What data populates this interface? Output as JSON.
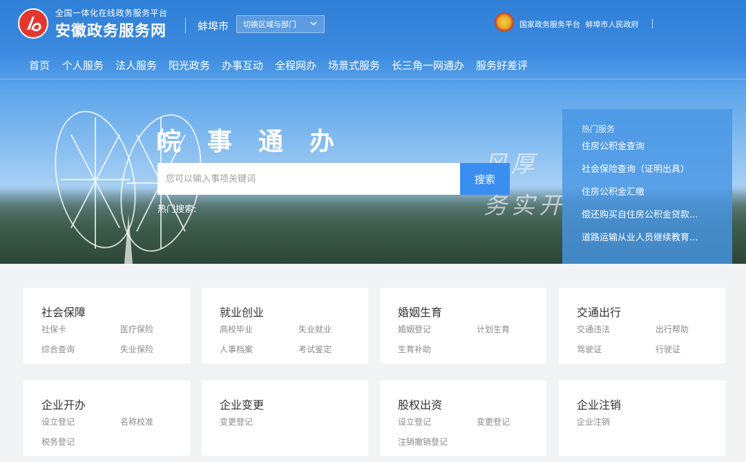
{
  "site": {
    "subtitle": "全国一体化在线政务服务平台",
    "title": "安徽政务服务网",
    "city": "蚌埠市",
    "switch_label": "切换区域与部门",
    "gov_links": [
      "国家政务服务平台",
      "蚌埠市人民政府"
    ]
  },
  "nav": [
    "首页",
    "个人服务",
    "法人服务",
    "阳光政务",
    "办事互动",
    "全程网办",
    "场景式服务",
    "长三角一网通办",
    "服务好差评"
  ],
  "banner": {
    "slogan": "皖事通办",
    "search_placeholder": "您可以输入事项关键词",
    "search_button": "搜索",
    "hot_search_label": "热门搜索:",
    "calligraphy": [
      "风厚",
      "务实开"
    ]
  },
  "hot_services": {
    "title": "热门服务",
    "items": [
      "住房公积金查询",
      "社会保险查询（证明出具）",
      "住房公积金汇缴",
      "偿还购买自住房公积金贷款...",
      "道路运输从业人员继续教育..."
    ]
  },
  "cards": [
    {
      "title": "社会保障",
      "links": [
        "社保卡",
        "医疗保险",
        "综合查询",
        "失业保险"
      ]
    },
    {
      "title": "就业创业",
      "links": [
        "高校毕业",
        "失业就业",
        "人事档案",
        "考试鉴定"
      ]
    },
    {
      "title": "婚姻生育",
      "links": [
        "婚姻登记",
        "计划生育",
        "生育补助"
      ]
    },
    {
      "title": "交通出行",
      "links": [
        "交通违法",
        "出行帮助",
        "驾驶证",
        "行驶证"
      ]
    },
    {
      "title": "企业开办",
      "links": [
        "设立登记",
        "名称校准",
        "税务登记"
      ]
    },
    {
      "title": "企业变更",
      "links": [
        "变更登记"
      ]
    },
    {
      "title": "股权出资",
      "links": [
        "设立登记",
        "变更登记",
        "注销撤销登记"
      ]
    },
    {
      "title": "企业注销",
      "links": [
        "企业注销"
      ]
    }
  ],
  "colors": {
    "primary": "#3a8ef0",
    "logo_red": "#e2372f"
  }
}
